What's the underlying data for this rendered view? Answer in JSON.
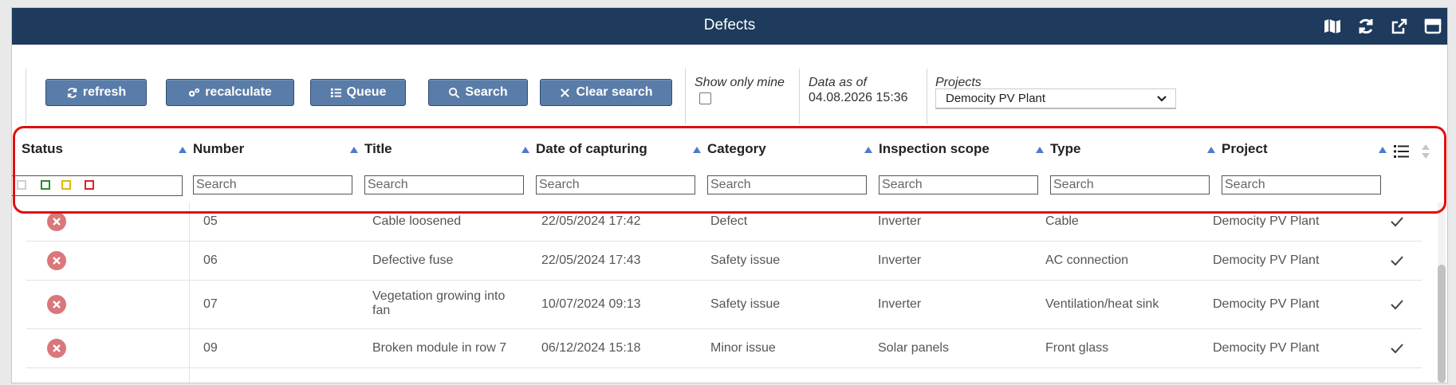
{
  "window": {
    "title": "Defects"
  },
  "title_icons": [
    "map-icon",
    "refresh-icon",
    "export-icon",
    "maximize-icon"
  ],
  "toolbar": {
    "refresh_label": "refresh",
    "recalculate_label": "recalculate",
    "queue_label": "Queue",
    "search_label": "Search",
    "clear_label": "Clear search",
    "show_only_mine_label": "Show only mine",
    "data_as_of_label": "Data as of",
    "data_as_of_value": "04.08.2026 15:36",
    "projects_label": "Projects",
    "projects_selected": "Democity PV Plant"
  },
  "columns": [
    {
      "key": "status",
      "label": "Status"
    },
    {
      "key": "number",
      "label": "Number"
    },
    {
      "key": "title",
      "label": "Title"
    },
    {
      "key": "date",
      "label": "Date of capturing"
    },
    {
      "key": "category",
      "label": "Category"
    },
    {
      "key": "scope",
      "label": "Inspection scope"
    },
    {
      "key": "type",
      "label": "Type"
    },
    {
      "key": "project",
      "label": "Project"
    }
  ],
  "search_placeholder": "Search",
  "status_filter_colors": {
    "grey": "#c9c9c9",
    "green": "#2e8b2e",
    "yellow": "#e0b800",
    "red": "#e01f1f"
  },
  "rows": [
    {
      "status": "rejected",
      "number": "05",
      "title": "Cable loosened",
      "date": "22/05/2024 17:42",
      "category": "Defect",
      "scope": "Inverter",
      "type": "Cable",
      "project": "Democity PV Plant"
    },
    {
      "status": "rejected",
      "number": "06",
      "title": "Defective fuse",
      "date": "22/05/2024 17:43",
      "category": "Safety issue",
      "scope": "Inverter",
      "type": "AC connection",
      "project": "Democity PV Plant"
    },
    {
      "status": "rejected",
      "number": "07",
      "title": "Vegetation growing into fan",
      "date": "10/07/2024 09:13",
      "category": "Safety issue",
      "scope": "Inverter",
      "type": "Ventilation/heat sink",
      "project": "Democity PV Plant"
    },
    {
      "status": "rejected",
      "number": "09",
      "title": "Broken module in row 7",
      "date": "06/12/2024 15:18",
      "category": "Minor issue",
      "scope": "Solar panels",
      "type": "Front glass",
      "project": "Democity PV Plant"
    }
  ],
  "colors": {
    "header_bg": "#1e3a5c",
    "button_bg": "#5a7ca8",
    "sort_arrow": "#4d7bd1",
    "status_rejected": "#d9777b",
    "highlight": "#e01010"
  }
}
